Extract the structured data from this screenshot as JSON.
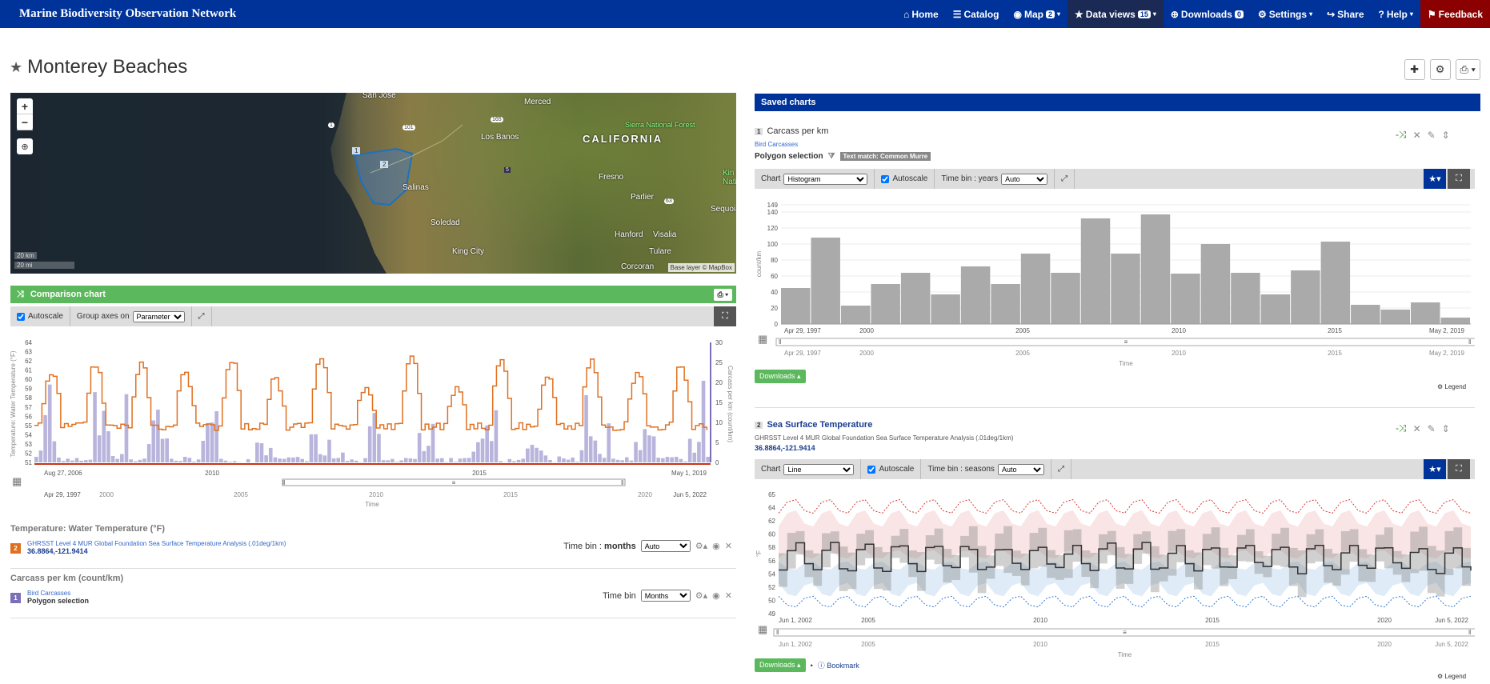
{
  "nav": {
    "brand": "Marine Biodiversity Observation Network",
    "items": [
      {
        "icon": "home-icon",
        "glyph": "⌂",
        "label": "Home",
        "badge": ""
      },
      {
        "icon": "catalog-icon",
        "glyph": "☰",
        "label": "Catalog",
        "badge": ""
      },
      {
        "icon": "map-icon",
        "glyph": "◉",
        "label": "Map",
        "badge": "2"
      },
      {
        "icon": "star-icon",
        "glyph": "★",
        "label": "Data views",
        "badge": "15"
      },
      {
        "icon": "download-icon",
        "glyph": "⊕",
        "label": "Downloads",
        "badge": "0"
      },
      {
        "icon": "gear-icon",
        "glyph": "⚙",
        "label": "Settings",
        "badge": ""
      },
      {
        "icon": "share-icon",
        "glyph": "↪",
        "label": "Share",
        "badge": ""
      },
      {
        "icon": "help-icon",
        "glyph": "?",
        "label": "Help",
        "badge": ""
      },
      {
        "icon": "flag-icon",
        "glyph": "⚑",
        "label": "Feedback",
        "badge": ""
      }
    ]
  },
  "page": {
    "title": "Monterey Beaches"
  },
  "map": {
    "labels": {
      "san_jose": "San Jose",
      "merced": "Merced",
      "los_banos": "Los Banos",
      "california": "CALIFORNIA",
      "sierra": "Sierra National Forest",
      "fresno": "Fresno",
      "salinas": "Salinas",
      "soledad": "Soledad",
      "parlier": "Parlier",
      "hanford": "Hanford",
      "visalia": "Visalia",
      "king_city": "King City",
      "tulare": "Tulare",
      "corcoran": "Corcoran",
      "sequoia": "Sequoia",
      "kings": "Kin Natio",
      "road_165": "165",
      "road_101": "101",
      "road_1": "1",
      "road_5": "5",
      "road_63": "63"
    },
    "polygon_labels": [
      "1",
      "2"
    ],
    "scale_km": "20 km",
    "scale_mi": "20 mi",
    "attribution": "Base layer © MapBox"
  },
  "comparison": {
    "title": "Comparison chart",
    "autoscale_label": "Autoscale",
    "group_axes_label": "Group axes on",
    "group_axes_value": "Parameter",
    "y_left_label": "Temperature: Water Temperature (°F)",
    "y_right_label": "Carcass per km (count/km)",
    "y_left_ticks": [
      "64",
      "63",
      "62",
      "61",
      "60",
      "59",
      "58",
      "57",
      "56",
      "55",
      "54",
      "53",
      "52",
      "51"
    ],
    "y_right_ticks": [
      "30",
      "25",
      "20",
      "15",
      "10",
      "5",
      "0"
    ],
    "x_ticks": [
      "Aug 27, 2006",
      "2010",
      "2015",
      "May 1, 2019"
    ],
    "nav_ticks": [
      "Apr 29, 1997",
      "2000",
      "2005",
      "2010",
      "2015",
      "2020",
      "Jun 5, 2022"
    ],
    "x_label": "Time",
    "layers": [
      {
        "heading": "Temperature: Water Temperature (°F)",
        "num": "2",
        "source": "GHRSST Level 4 MUR Global Foundation Sea Surface Temperature Analysis (.01deg/1km)",
        "location": "36.8864,-121.9414",
        "timebin_label": "Time bin : ",
        "timebin_unit": "months",
        "timebin_value": "Auto"
      },
      {
        "heading": "Carcass per km (count/km)",
        "num": "1",
        "source": "Bird Carcasses",
        "location": "Polygon selection",
        "timebin_label": "Time bin",
        "timebin_unit": "",
        "timebin_value": "Months"
      }
    ]
  },
  "saved": {
    "title": "Saved charts",
    "chart1": {
      "num": "1",
      "title": "Carcass per km",
      "source": "Bird Carcasses",
      "selection": "Polygon selection",
      "filter_tag": "Text match: Common Murre",
      "chart_label": "Chart",
      "chart_type": "Histogram",
      "autoscale": "Autoscale",
      "timebin_label": "Time bin : years",
      "timebin_value": "Auto",
      "y_label": "count/km",
      "y_ticks": [
        "149",
        "140",
        "120",
        "100",
        "80",
        "60",
        "40",
        "20",
        "0"
      ],
      "x_ticks": [
        "Apr 29, 1997",
        "2000",
        "2005",
        "2010",
        "2015",
        "May 2, 2019"
      ],
      "nav_ticks": [
        "Apr 29, 1997",
        "2000",
        "2005",
        "2010",
        "2015",
        "May 2, 2019"
      ],
      "x_label": "Time",
      "downloads": "Downloads",
      "legend": "Legend"
    },
    "chart2": {
      "num": "2",
      "title": "Sea Surface Temperature",
      "source": "GHRSST Level 4 MUR Global Foundation Sea Surface Temperature Analysis (.01deg/1km)",
      "location": "36.8864,-121.9414",
      "chart_label": "Chart",
      "chart_type": "Line",
      "autoscale": "Autoscale",
      "timebin_label": "Time bin : seasons",
      "timebin_value": "Auto",
      "y_label": "°F",
      "y_ticks": [
        "65",
        "64",
        "62",
        "60",
        "58",
        "56",
        "54",
        "52",
        "50",
        "49"
      ],
      "x_ticks": [
        "Jun 1, 2002",
        "2005",
        "2010",
        "2015",
        "2020",
        "Jun 5, 2022"
      ],
      "nav_ticks": [
        "Jun 1, 2002",
        "2005",
        "2010",
        "2015",
        "2020",
        "Jun 5, 2022"
      ],
      "x_label": "Time",
      "downloads": "Downloads",
      "bookmark": "Bookmark",
      "legend": "Legend"
    }
  },
  "colors": {
    "nav": "#003399",
    "green": "#5cb85c",
    "orange": "#e07020",
    "purple": "#b9b4dc",
    "bar": "#aaaaaa"
  },
  "chart_data": [
    {
      "type": "bar",
      "title": "Carcass per km",
      "ylabel": "count/km",
      "xlabel": "Time",
      "ylim": [
        0,
        149
      ],
      "categories": [
        "1997",
        "1998",
        "1999",
        "2000",
        "2001",
        "2002",
        "2003",
        "2004",
        "2005",
        "2006",
        "2007",
        "2008",
        "2009",
        "2010",
        "2011",
        "2012",
        "2013",
        "2014",
        "2015",
        "2016",
        "2017",
        "2018",
        "2019"
      ],
      "values": [
        45,
        108,
        23,
        50,
        64,
        37,
        72,
        50,
        88,
        64,
        132,
        88,
        137,
        63,
        100,
        64,
        37,
        67,
        103,
        24,
        18,
        27,
        8
      ]
    }
  ]
}
